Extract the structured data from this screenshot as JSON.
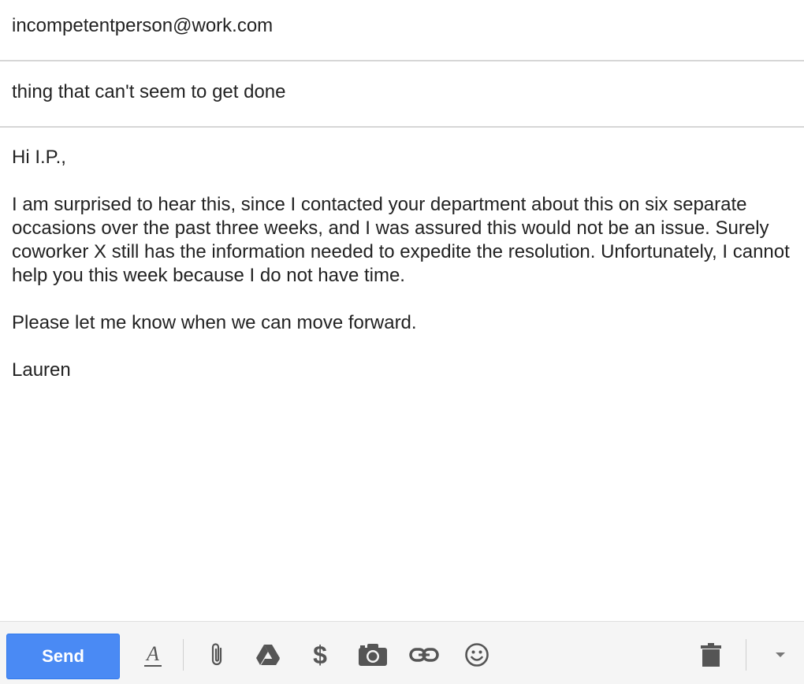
{
  "recipient": {
    "value": "incompetentperson@work.com"
  },
  "subject": {
    "value": "thing that can't seem to get done"
  },
  "body": {
    "greeting": "Hi I.P.,",
    "paragraph": "I am surprised to hear this, since I contacted your department about this on six separate occasions over the past three weeks, and I was assured this would not be an issue. Surely coworker X still has the information needed to expedite the resolution. Unfortunately, I cannot help you this week because I do not have time.",
    "closing_line": "Please let me know when we can move forward.",
    "signature": "Lauren"
  },
  "toolbar": {
    "send_label": "Send",
    "icons": [
      "text-format-icon",
      "attach-icon",
      "drive-icon",
      "dollar-icon",
      "camera-icon",
      "link-icon",
      "emoji-icon",
      "trash-icon",
      "more-options-icon"
    ]
  },
  "colors": {
    "send_button": "#4a8af4",
    "toolbar_background": "#f5f5f5",
    "icon": "#555555",
    "divider": "#d6d6d6"
  }
}
